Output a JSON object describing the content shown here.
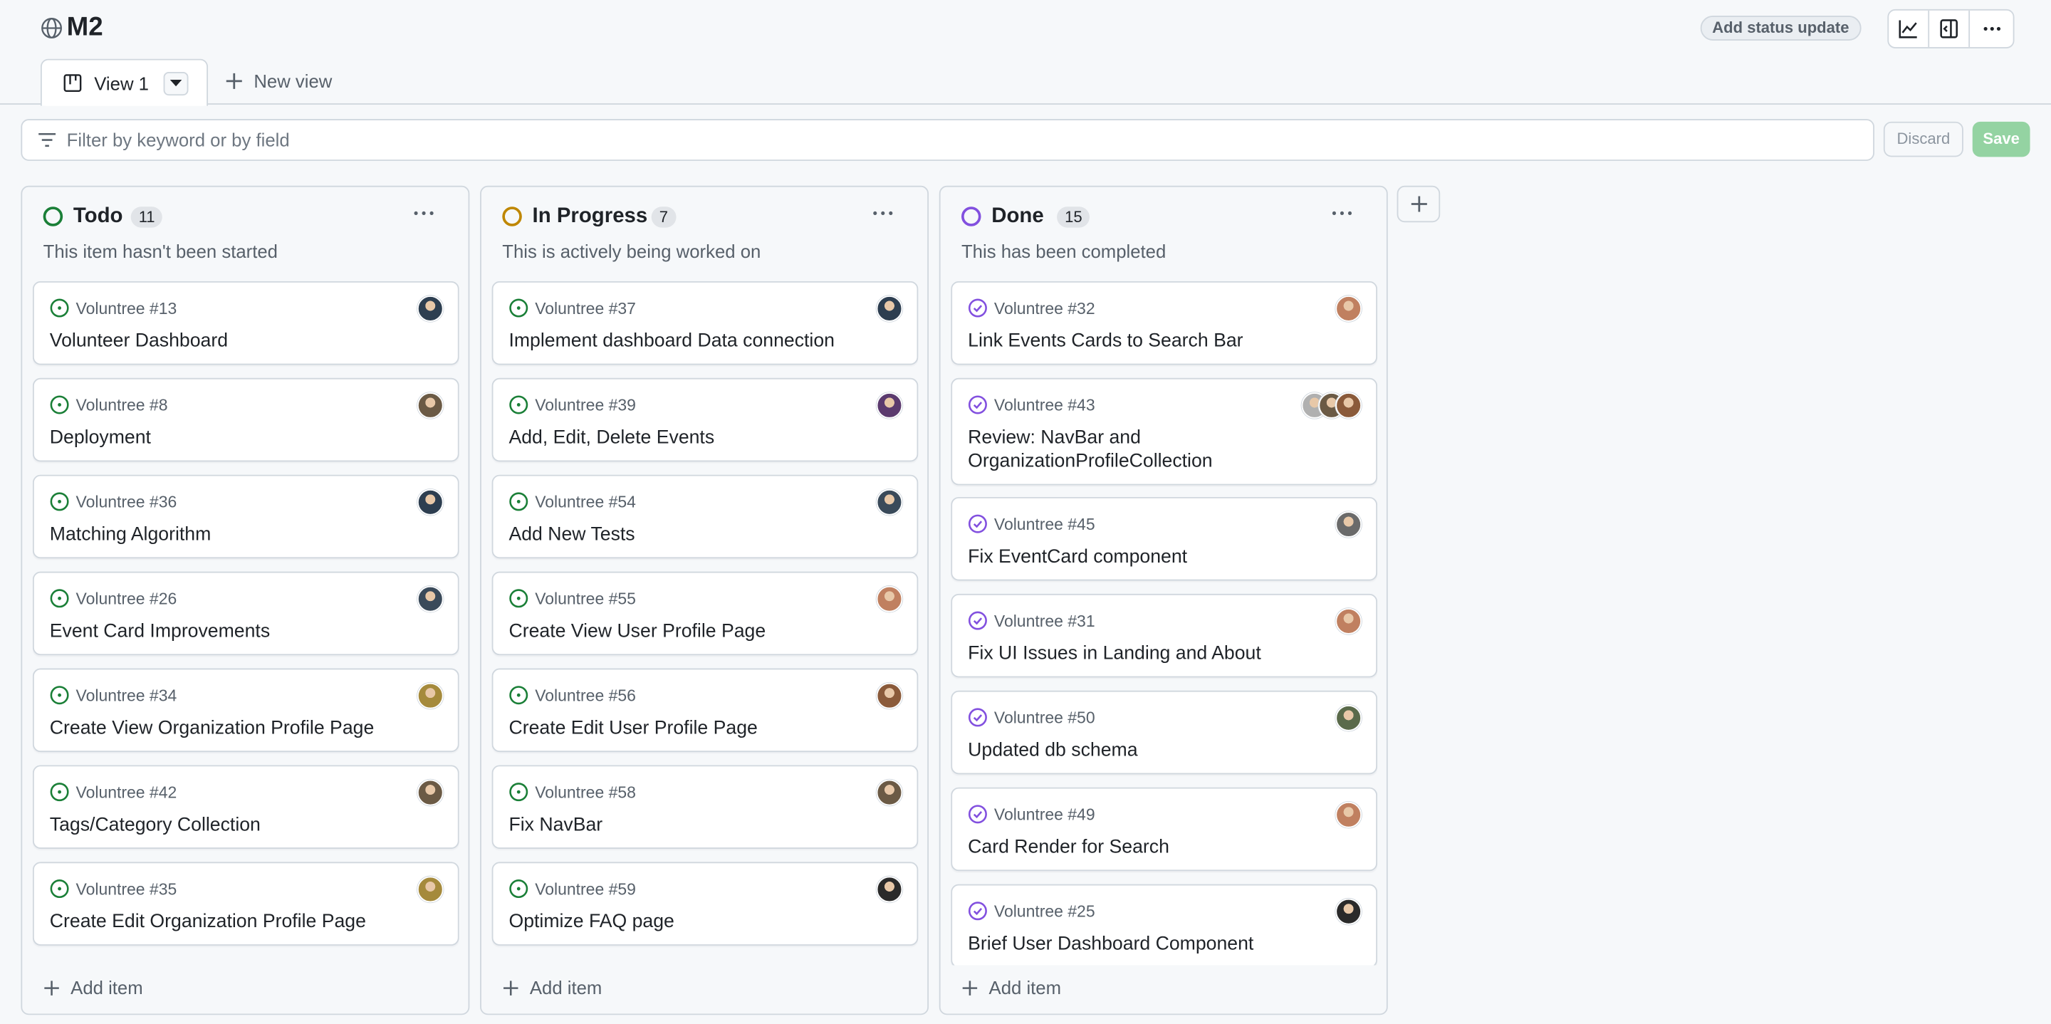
{
  "header": {
    "title": "M2",
    "status_button": "Add status update",
    "icons": [
      "insights-icon",
      "side-panel-icon",
      "kebab-menu-icon"
    ]
  },
  "tabs": {
    "active_label": "View 1",
    "new_view_label": "New view"
  },
  "filter": {
    "placeholder": "Filter by keyword or by field",
    "discard_label": "Discard",
    "save_label": "Save"
  },
  "colors": {
    "open_green": "#1a7f37",
    "in_progress_yellow": "#bf8700",
    "done_purple": "#8250df",
    "save_disabled": "#94d3a2"
  },
  "columns": [
    {
      "name": "Todo",
      "count": "11",
      "description": "This item hasn't been started",
      "status": "todo",
      "add_item_label": "Add item",
      "cards": [
        {
          "ref": "Voluntree #13",
          "title": "Volunteer Dashboard",
          "avatars": [
            "#2d3e50"
          ]
        },
        {
          "ref": "Voluntree #8",
          "title": "Deployment",
          "avatars": [
            "#6b5a45"
          ]
        },
        {
          "ref": "Voluntree #36",
          "title": "Matching Algorithm",
          "avatars": [
            "#2d3e50"
          ]
        },
        {
          "ref": "Voluntree #26",
          "title": "Event Card Improvements",
          "avatars": [
            "#3a4a5a"
          ]
        },
        {
          "ref": "Voluntree #34",
          "title": "Create View Organization Profile Page",
          "avatars": [
            "#a58a3c"
          ]
        },
        {
          "ref": "Voluntree #42",
          "title": "Tags/Category Collection",
          "avatars": [
            "#6b5a45"
          ]
        },
        {
          "ref": "Voluntree #35",
          "title": "Create Edit Organization Profile Page",
          "avatars": [
            "#a58a3c"
          ]
        }
      ]
    },
    {
      "name": "In Progress",
      "count": "7",
      "description": "This is actively being worked on",
      "status": "in-progress",
      "add_item_label": "Add item",
      "cards": [
        {
          "ref": "Voluntree #37",
          "title": "Implement dashboard Data connection",
          "avatars": [
            "#2d3e50"
          ]
        },
        {
          "ref": "Voluntree #39",
          "title": "Add, Edit, Delete Events",
          "avatars": [
            "#5b3a6e"
          ]
        },
        {
          "ref": "Voluntree #54",
          "title": "Add New Tests",
          "avatars": [
            "#3a4a5a"
          ]
        },
        {
          "ref": "Voluntree #55",
          "title": "Create View User Profile Page",
          "avatars": [
            "#c08060"
          ]
        },
        {
          "ref": "Voluntree #56",
          "title": "Create Edit User Profile Page",
          "avatars": [
            "#8a5a3a"
          ]
        },
        {
          "ref": "Voluntree #58",
          "title": "Fix NavBar",
          "avatars": [
            "#6b5a45"
          ]
        },
        {
          "ref": "Voluntree #59",
          "title": "Optimize FAQ page",
          "avatars": [
            "#2a2a2a"
          ]
        }
      ]
    },
    {
      "name": "Done",
      "count": "15",
      "description": "This has been completed",
      "status": "done",
      "add_item_label": "Add item",
      "cards": [
        {
          "ref": "Voluntree #32",
          "title": "Link Events Cards to Search Bar",
          "avatars": [
            "#c08060"
          ]
        },
        {
          "ref": "Voluntree #43",
          "title": "Review: NavBar and OrganizationProfileCollection",
          "avatars": [
            "#b0b0b0",
            "#6b5a45",
            "#8a5a3a"
          ]
        },
        {
          "ref": "Voluntree #45",
          "title": "Fix EventCard component",
          "avatars": [
            "#6a6a6a"
          ]
        },
        {
          "ref": "Voluntree #31",
          "title": "Fix UI Issues in Landing and About",
          "avatars": [
            "#c08060"
          ]
        },
        {
          "ref": "Voluntree #50",
          "title": "Updated db schema",
          "avatars": [
            "#5a6a4a"
          ]
        },
        {
          "ref": "Voluntree #49",
          "title": "Card Render for Search",
          "avatars": [
            "#c08060"
          ]
        },
        {
          "ref": "Voluntree #25",
          "title": "Brief User Dashboard Component",
          "avatars": [
            "#2a2a2a"
          ]
        }
      ]
    }
  ]
}
